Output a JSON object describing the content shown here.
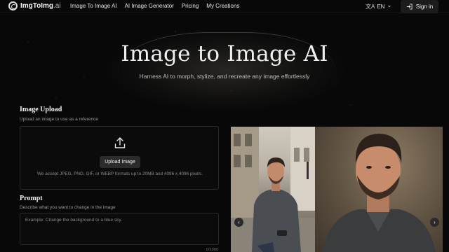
{
  "brand": {
    "name_bold": "ImgToImg",
    "name_suffix": ".ai"
  },
  "nav": {
    "links": [
      "Image To Image AI",
      "AI Image Generator",
      "Pricing",
      "My Creations"
    ],
    "lang_glyph": "文A",
    "lang_label": "EN",
    "lang_chevron": "⌄",
    "signin_label": "Sign in",
    "signin_icon": "login-arrow-icon"
  },
  "hero": {
    "title": "Image to Image AI",
    "subtitle": "Harness AI to morph, stylize, and recreate any image effortlessly"
  },
  "upload": {
    "title": "Image Upload",
    "description": "Upload an image to use as a reference",
    "button_label": "Upload Image",
    "icon": "upload-icon",
    "note": "We accept JPEG, PNG, GIF, or WEBP formats up to 20MB and 4096 x 4096 pixels."
  },
  "prompt": {
    "title": "Prompt",
    "description": "Describe what you want to change in the image",
    "placeholder": "Example: Change the background to a blue sky.",
    "char_count": "0/1000"
  },
  "compare": {
    "prev_glyph": "‹",
    "next_glyph": "›"
  },
  "colors": {
    "background": "#080808",
    "nav_button_bg": "#1c1c1c",
    "upload_button_bg": "#2b2b2b",
    "border": "#2a2a2a"
  }
}
